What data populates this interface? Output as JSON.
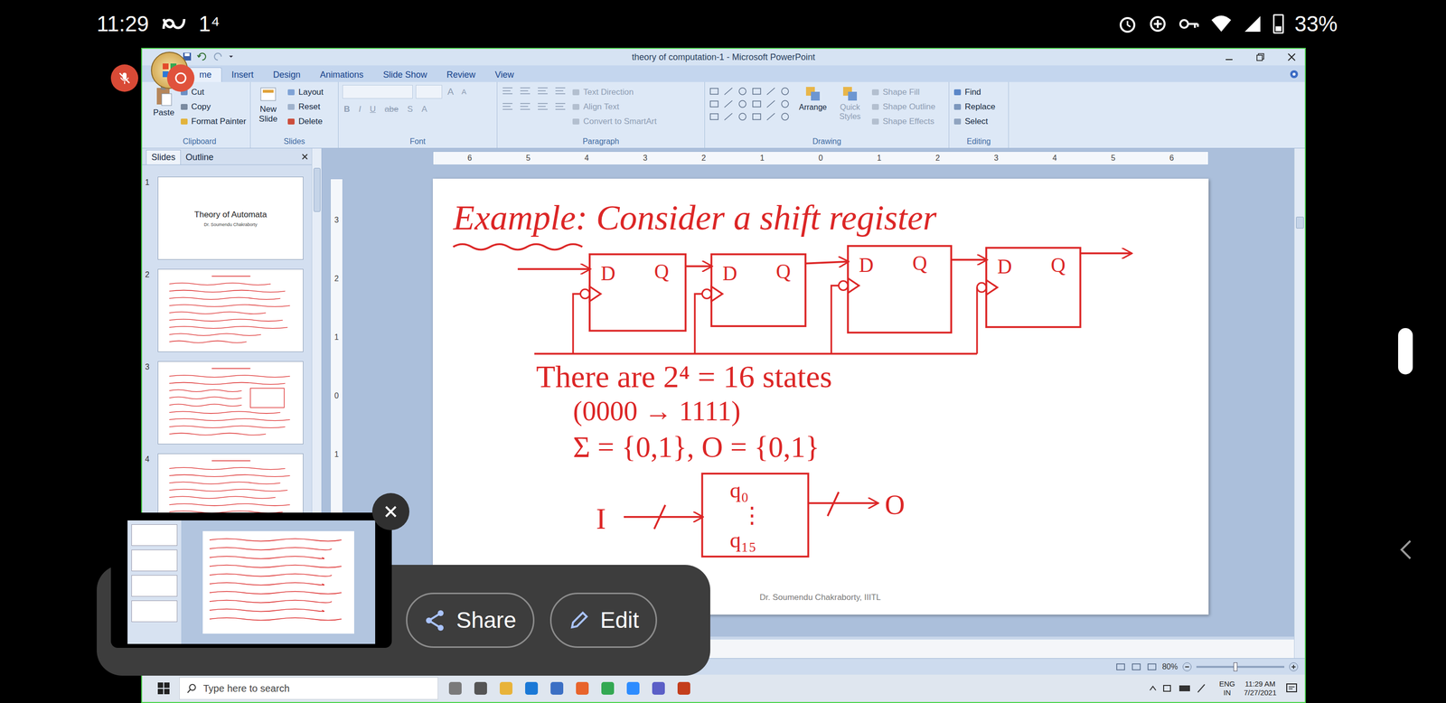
{
  "phone_status": {
    "time": "11:29",
    "badge": "1⁴",
    "battery": "33%",
    "battery_level": 0.33
  },
  "window": {
    "title": "theory of computation-1 - Microsoft PowerPoint"
  },
  "ribbon_tabs": [
    {
      "label": "me",
      "selected": true
    },
    {
      "label": "Insert",
      "selected": false
    },
    {
      "label": "Design",
      "selected": false
    },
    {
      "label": "Animations",
      "selected": false
    },
    {
      "label": "Slide Show",
      "selected": false
    },
    {
      "label": "Review",
      "selected": false
    },
    {
      "label": "View",
      "selected": false
    }
  ],
  "ribbon": {
    "clipboard": {
      "label": "Clipboard",
      "disabled": false,
      "big": "Paste",
      "small": [
        "Cut",
        "Copy",
        "Format Painter"
      ]
    },
    "slides": {
      "label": "Slides",
      "disabled": false,
      "big": "New Slide",
      "small": [
        "Layout",
        "Reset",
        "Delete"
      ]
    },
    "font": {
      "label": "Font",
      "disabled": true,
      "size_buttons": [
        "A",
        "A"
      ],
      "format_buttons": [
        "B",
        "I",
        "U",
        "abe",
        "S",
        "A"
      ]
    },
    "paragraph": {
      "label": "Paragraph",
      "disabled": true,
      "small": [
        "Text Direction",
        "Align Text",
        "Convert to SmartArt"
      ]
    },
    "drawing": {
      "label": "Drawing",
      "disabled": true,
      "big": [
        "Arrange",
        "Quick Styles"
      ],
      "small": [
        "Shape Fill",
        "Shape Outline",
        "Shape Effects"
      ]
    },
    "editing": {
      "label": "Editing",
      "disabled": false,
      "small": [
        "Find",
        "Replace",
        "Select"
      ]
    }
  },
  "slides_pane": {
    "tabs": [
      {
        "label": "Slides",
        "selected": true
      },
      {
        "label": "Outline",
        "selected": false
      }
    ],
    "slides": [
      {
        "number": "1",
        "kind": "title",
        "title": "Theory of Automata",
        "subtitle": "Dr. Soumendu Chakraborty"
      },
      {
        "number": "2",
        "kind": "ink"
      },
      {
        "number": "3",
        "kind": "ink"
      },
      {
        "number": "4",
        "kind": "ink"
      }
    ]
  },
  "ruler": {
    "horizontal": [
      "6",
      "5",
      "4",
      "3",
      "2",
      "1",
      "0",
      "1",
      "2",
      "3",
      "4",
      "5",
      "6"
    ],
    "vertical": [
      "3",
      "2",
      "1",
      "0",
      "1"
    ]
  },
  "slide": {
    "title": "Example: Consider a shift register",
    "flip_flops": [
      {
        "d": "D",
        "q": "Q"
      },
      {
        "d": "D",
        "q": "Q"
      },
      {
        "d": "D",
        "q": "Q"
      },
      {
        "d": "D",
        "q": "Q"
      }
    ],
    "states_line": "There are 2⁴ = 16 states",
    "range_line": "(0000 → 1111)",
    "alphabet_line": "Σ = {0,1}, O = {0,1}",
    "machine": {
      "input": "I",
      "output": "O",
      "states": [
        "q₀",
        "⋮",
        "q₁₅"
      ]
    },
    "footer": "Dr. Soumendu Chakraborty, IIITL"
  },
  "status_bar": {
    "zoom": "80%",
    "zoom_level": 0.42
  },
  "taskbar": {
    "search_placeholder": "Type here to search",
    "language": "ENG",
    "region": "IN",
    "time": "11:29 AM",
    "date": "7/27/2021"
  },
  "screenshot_preview": {
    "buttons": [
      {
        "label": "Share",
        "kind": "share"
      },
      {
        "label": "Edit",
        "kind": "edit"
      }
    ]
  }
}
